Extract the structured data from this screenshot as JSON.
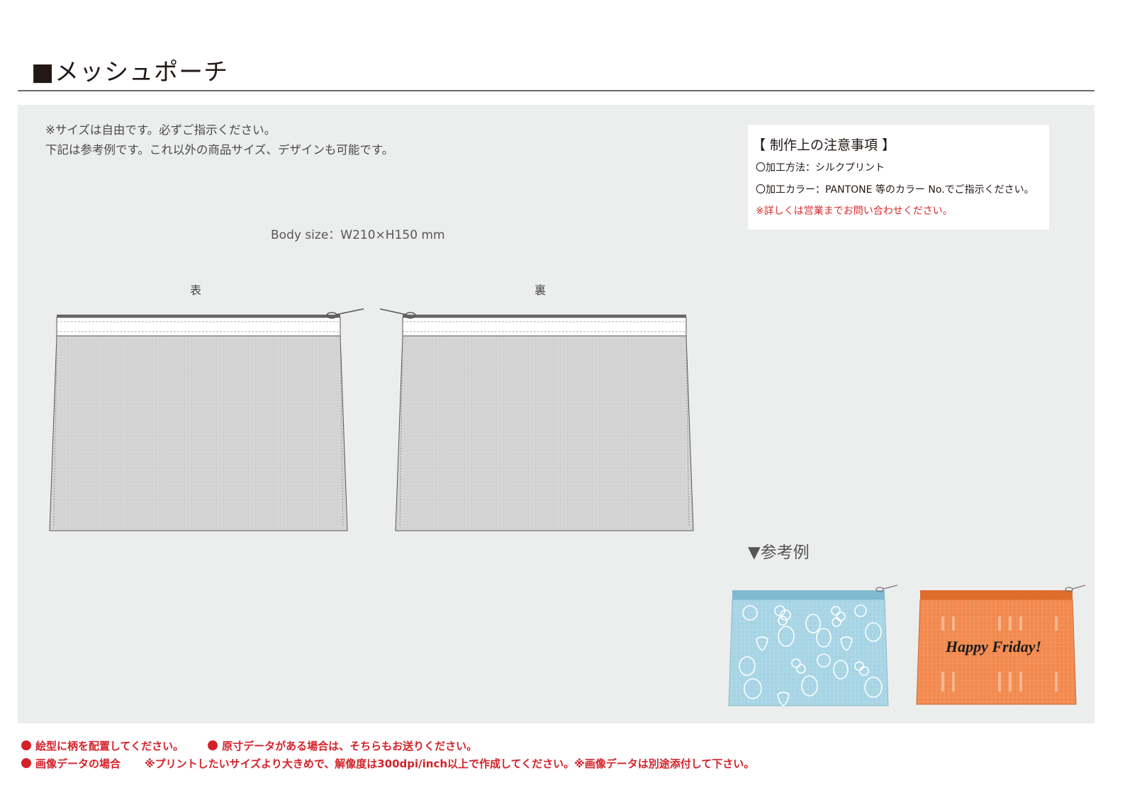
{
  "title": "■メッシュポーチ",
  "intro": {
    "line1": "※サイズは自由です。必ずご指示ください。",
    "line2": "下記は参考例です。これ以外の商品サイズ、デザインも可能です。"
  },
  "body_size": "Body size：W210×H150 mm",
  "labels": {
    "front": "表",
    "back": "裏"
  },
  "notes": {
    "title": "【 制作上の注意事項 】",
    "method": "〇加工方法：シルクプリント",
    "color": "〇加工カラー：PANTONE 等のカラー No.でご指示ください。",
    "contact": "※詳しくは営業までお問い合わせください。"
  },
  "reference": {
    "heading": "▼参考例",
    "example2_text": "Happy Friday!"
  },
  "footer": {
    "item1": "絵型に柄を配置してください。",
    "item2": "原寸データがある場合は、そちらもお送りください。",
    "item3": "画像データの場合",
    "item3_detail": "※プリントしたいサイズより大きめで、解像度は300dpi/inch以上で作成してください。※画像データは別途添付して下さい。"
  },
  "colors": {
    "panel": "#eceeed",
    "mesh": "#d9d9d9",
    "example1": "#9fd0e0",
    "example2": "#f0864a",
    "footer_red": "#d3222a"
  }
}
